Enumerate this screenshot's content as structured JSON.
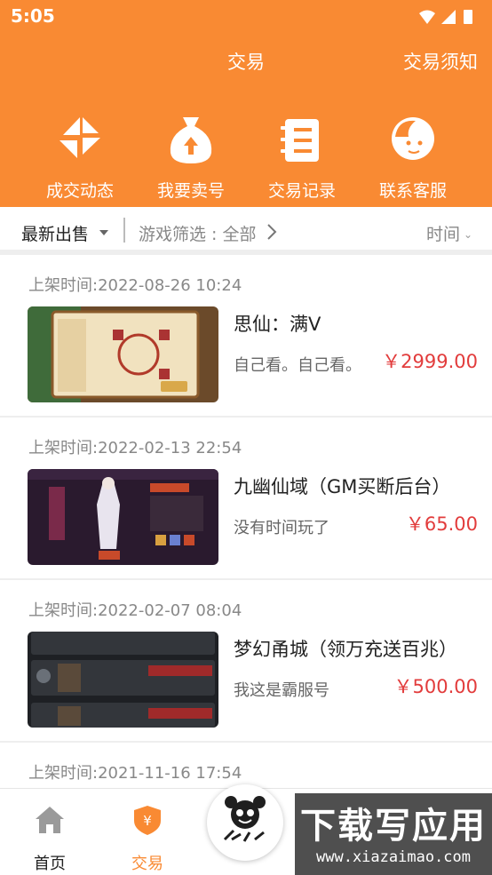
{
  "status_bar": {
    "time": "5:05"
  },
  "header": {
    "title": "交易",
    "notice_link": "交易须知"
  },
  "quick_actions": [
    {
      "label": "成交动态",
      "icon": "deals-feed-icon"
    },
    {
      "label": "我要卖号",
      "icon": "money-bag-upload-icon"
    },
    {
      "label": "交易记录",
      "icon": "records-document-icon"
    },
    {
      "label": "联系客服",
      "icon": "customer-service-icon"
    }
  ],
  "filter_bar": {
    "latest": "最新出售",
    "game_filter": "游戏筛选 : 全部",
    "time_sort": "时间"
  },
  "listings": [
    {
      "time": "上架时间:2022-08-26 10:24",
      "title": "思仙：满V",
      "desc": "自己看。自己看。",
      "price": "￥2999.00"
    },
    {
      "time": "上架时间:2022-02-13 22:54",
      "title": "九幽仙域（GM买断后台）",
      "desc": "没有时间玩了",
      "price": "￥65.00"
    },
    {
      "time": "上架时间:2022-02-07 08:04",
      "title": "梦幻甬城（领万充送百兆）",
      "desc": "我这是霸服号",
      "price": "￥500.00"
    },
    {
      "time": "上架时间:2021-11-16 17:54",
      "title": "",
      "desc": "",
      "price": ""
    }
  ],
  "tab_bar": {
    "home": "首页",
    "trade": "交易"
  },
  "watermark": {
    "main": "下载写应用",
    "url": "www.xiazaimao.com"
  },
  "colors": {
    "accent": "#f98a33",
    "price": "#e23c3c",
    "tab_active": "#f98a33",
    "tab_inactive": "#9a9a9a"
  }
}
